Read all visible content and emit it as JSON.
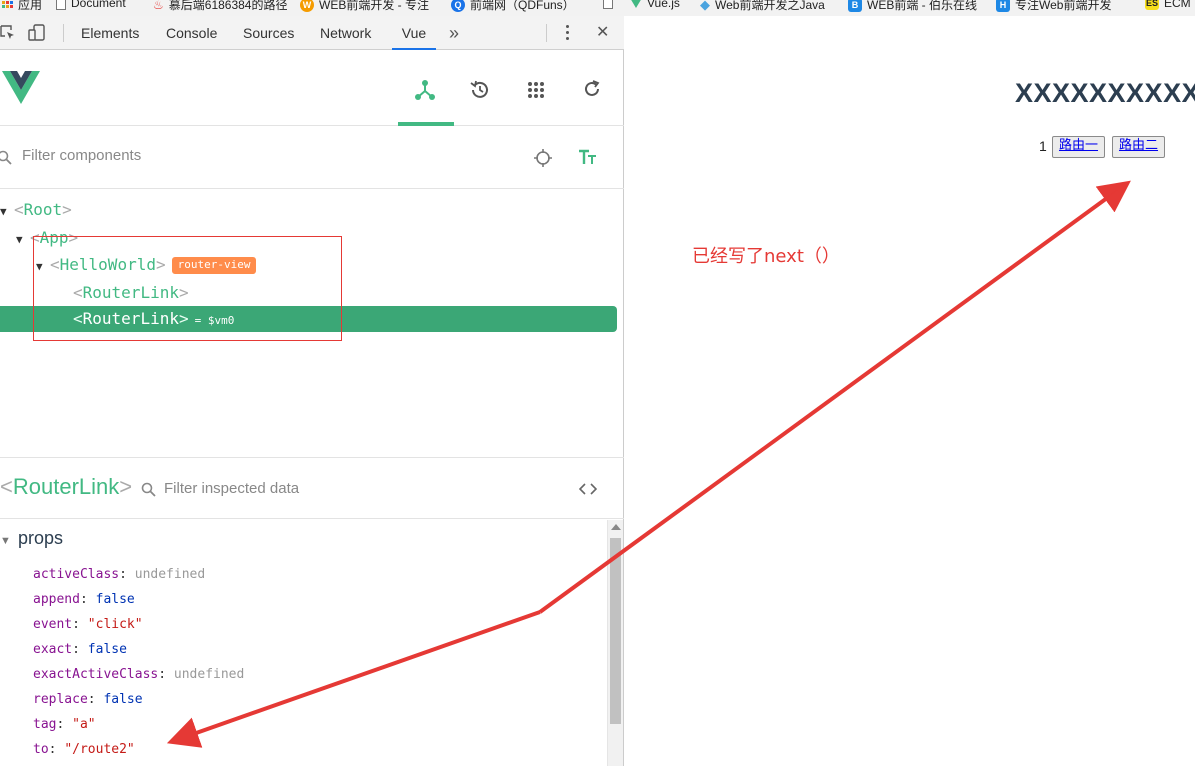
{
  "bookmarks": [
    {
      "label": "应用",
      "icon": "apps-icon",
      "color": "#e8a317"
    },
    {
      "label": "Document",
      "icon": "page-icon",
      "color": "#ffffff"
    },
    {
      "label": "慕后端6186384的路径",
      "icon": "flame-icon",
      "color": "#e53935"
    },
    {
      "label": "WEB前端开发 - 专注",
      "icon": "wb-icon",
      "color": "#f59c00"
    },
    {
      "label": "前端网（QDFuns）",
      "icon": "qd-icon",
      "color": "#1a73e8"
    },
    {
      "label": "",
      "icon": "page-icon",
      "color": "#ffffff"
    },
    {
      "label": "Vue.js",
      "icon": "vue-icon",
      "color": "#42b983"
    },
    {
      "label": "Web前端开发之Java",
      "icon": "diamond-icon",
      "color": "#4aa3df"
    },
    {
      "label": "WEB前端 - 伯乐在线",
      "icon": "b-icon",
      "color": "#1e88e5"
    },
    {
      "label": "专注Web前端开发",
      "icon": "h-icon",
      "color": "#1e88e5"
    },
    {
      "label": "ECM",
      "icon": "es-icon",
      "color": "#f7df1e"
    }
  ],
  "devtools": {
    "tabs": [
      "Elements",
      "Console",
      "Sources",
      "Network",
      "Vue"
    ],
    "active_tab": "Vue",
    "more": "»",
    "close": "✕"
  },
  "vue": {
    "filter_components_placeholder": "Filter components",
    "tree": {
      "root": "Root",
      "app": "App",
      "hello": "HelloWorld",
      "hello_badge": "router-view",
      "link1": "RouterLink",
      "link2": "RouterLink",
      "link2_vm": "= $vm0"
    },
    "inspected_component": "RouterLink",
    "filter_inspected_placeholder": "Filter inspected data",
    "props_title": "props",
    "props": [
      {
        "key": "activeClass",
        "value": "undefined",
        "kind": "undef"
      },
      {
        "key": "append",
        "value": "false",
        "kind": "bool"
      },
      {
        "key": "event",
        "value": "\"click\"",
        "kind": "str"
      },
      {
        "key": "exact",
        "value": "false",
        "kind": "bool"
      },
      {
        "key": "exactActiveClass",
        "value": "undefined",
        "kind": "undef"
      },
      {
        "key": "replace",
        "value": "false",
        "kind": "bool"
      },
      {
        "key": "tag",
        "value": "\"a\"",
        "kind": "str"
      },
      {
        "key": "to",
        "value": "\"/route2\"",
        "kind": "str"
      }
    ]
  },
  "page": {
    "title": "XXXXXXXXXX",
    "route_number": "1",
    "route1": "路由一",
    "route2": "路由二",
    "annotation": "已经写了next（）"
  },
  "colors": {
    "vue_green": "#42b983",
    "selected_row": "#3ba776",
    "badge_orange": "#ff8c4b",
    "annotation_red": "#e53935"
  }
}
